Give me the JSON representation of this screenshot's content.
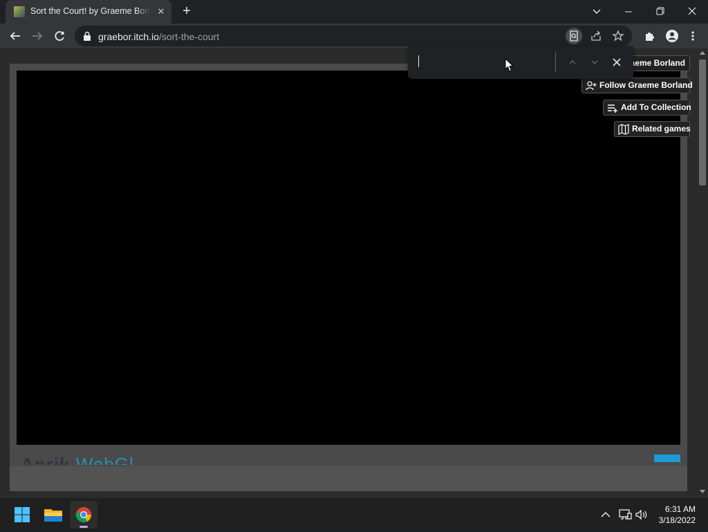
{
  "browser": {
    "tab": {
      "title": "Sort the Court! by Graeme Borland"
    },
    "url": {
      "host": "graebor.itch.io",
      "path": "/sort-the-court"
    }
  },
  "find_bar": {
    "query": "",
    "placeholder": ""
  },
  "page": {
    "actions": {
      "more_games": "raeme Borland",
      "follow": "Follow Graeme Borland",
      "add_to_collection": "Add To Collection",
      "related_games": "Related games"
    },
    "footer_logo": {
      "dark": "Anrik",
      "blue": "WebGl"
    }
  },
  "taskbar": {
    "time": "6:31 AM",
    "date": "3/18/2022"
  },
  "colors": {
    "accent": "#1e9ad6",
    "tab_bg": "#35363a",
    "chrome_bg": "#202124"
  },
  "icons": [
    "back-icon",
    "forward-icon",
    "reload-icon",
    "lock-icon",
    "find-icon",
    "share-icon",
    "star-icon",
    "extensions-icon",
    "profile-icon",
    "menu-icon",
    "windows-start-icon",
    "file-explorer-icon",
    "chrome-icon"
  ]
}
